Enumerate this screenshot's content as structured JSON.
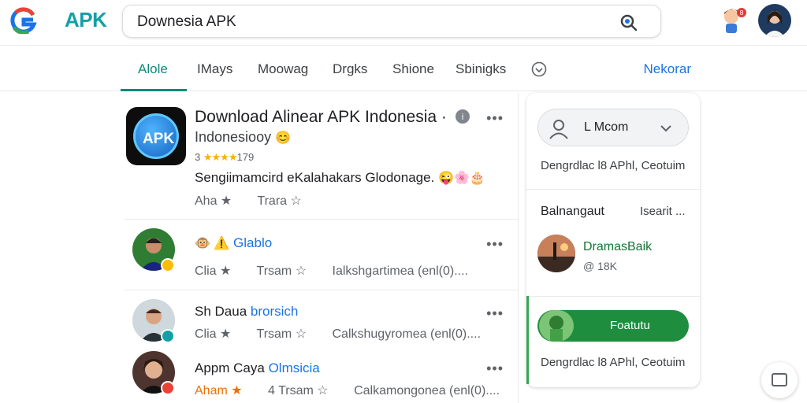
{
  "header": {
    "brand": "APK",
    "search": {
      "value": "Downesia APK"
    }
  },
  "tabs": [
    {
      "label": "Alole",
      "active": true
    },
    {
      "label": "IMays"
    },
    {
      "label": "Moowag"
    },
    {
      "label": "Drgks"
    },
    {
      "label": "Shione"
    },
    {
      "label": "Sbinigks"
    }
  ],
  "tabs_extra": "Nekorar",
  "featured": {
    "icon_text": "APK",
    "title": "Download Alinear APK Indonesia ·",
    "subtitle": "Indonesiooy",
    "rating_prefix": "3",
    "rating_stars": "★★★★",
    "rating_count": "179",
    "description": "Sengiimamcird eKalahakars Glodonage.",
    "actions": [
      "Aha ★",
      "Trara ☆"
    ]
  },
  "rows": [
    {
      "title_prefix": "",
      "title_highlight": "Glablo",
      "actions": [
        "Clia ★",
        "Trsam ☆",
        "Ialkshgartimea (enl(0)...."
      ]
    },
    {
      "title_prefix": "Sh Daua",
      "title_highlight": "brorsich",
      "actions": [
        "Clia ★",
        "Trsam ☆",
        "Calkshugyromea (enl(0)...."
      ]
    },
    {
      "title_prefix": "Appm Caya",
      "title_highlight": "Olmsicia",
      "actions": [
        "Aham ★",
        "4 Trsam ☆",
        "Calkamongonea (enl(0)...."
      ]
    }
  ],
  "sidebar": {
    "profile_name": "L Mcom",
    "info_line": "Dengrdlac l8 APhl, Ceotuim",
    "section_left": "Balnangaut",
    "section_right": "Isearit ...",
    "item_title": "DramasBaik",
    "item_meta": "@ 18K",
    "install_label": "Foatutu",
    "footer_line": "Dengrdlac l8 APhl, Ceotuim"
  },
  "colors": {
    "accent": "#0f8a7c",
    "link": "#1a73e8",
    "install": "#1e8e3e",
    "star": "#f4b400"
  }
}
